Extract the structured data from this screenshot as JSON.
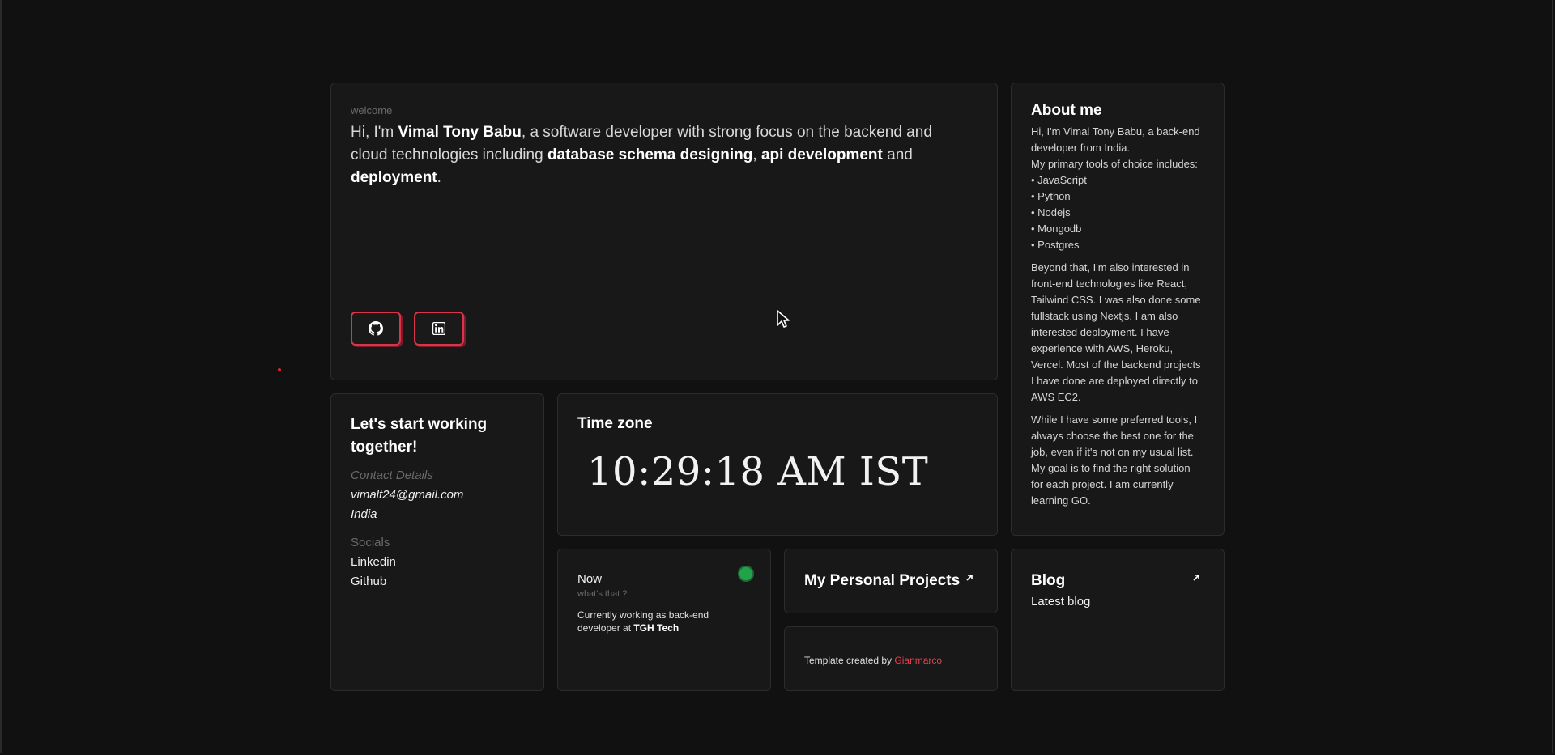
{
  "welcome": {
    "label": "welcome",
    "intro_parts": [
      {
        "text": "Hi, I'm ",
        "bold": false
      },
      {
        "text": "Vimal Tony Babu",
        "bold": true
      },
      {
        "text": ", a software developer with strong focus on the backend and cloud technologies including ",
        "bold": false
      },
      {
        "text": "database schema designing",
        "bold": true
      },
      {
        "text": ", ",
        "bold": false
      },
      {
        "text": "api development",
        "bold": true
      },
      {
        "text": " and ",
        "bold": false
      },
      {
        "text": "deployment",
        "bold": true
      },
      {
        "text": ".",
        "bold": false
      }
    ],
    "buttons": [
      {
        "name": "github-button",
        "icon": "github-icon"
      },
      {
        "name": "linkedin-button",
        "icon": "linkedin-icon"
      }
    ]
  },
  "about": {
    "title": "About me",
    "intro": "Hi, I'm Vimal Tony Babu, a back-end developer from India.",
    "tools_intro": "My primary tools of choice includes:",
    "tools": [
      "JavaScript",
      "Python",
      "Nodejs",
      "Mongodb",
      "Postgres"
    ],
    "paragraph1": "Beyond that, I'm also interested in front-end technologies like React, Tailwind CSS. I was also done some fullstack using Nextjs. I am also interested deployment. I have experience with AWS, Heroku, Vercel. Most of the backend projects I have done are deployed directly to AWS EC2.",
    "paragraph2": "While I have some preferred tools, I always choose the best one for the job, even if it's not on my usual list. My goal is to find the right solution for each project. I am currently learning GO."
  },
  "contact": {
    "title": "Let's start working together!",
    "details_label": "Contact Details",
    "email": "vimalt24@gmail.com",
    "country": "India",
    "socials_label": "Socials",
    "socials": [
      "Linkedin",
      "Github"
    ]
  },
  "timezone": {
    "title": "Time zone",
    "time": "10:29:18 AM IST"
  },
  "now": {
    "title": "Now",
    "question": "what's that ?",
    "desc_prefix": "Currently working as back-end developer at ",
    "company": "TGH Tech",
    "status_color": "#22a349"
  },
  "projects": {
    "title": "My Personal Projects",
    "icon": "arrow-up-right-icon"
  },
  "template": {
    "prefix": "Template created by ",
    "author": "Gianmarco"
  },
  "blog": {
    "title": "Blog",
    "latest": "Latest blog",
    "icon": "arrow-up-right-icon"
  },
  "colors": {
    "background": "#111111",
    "card": "#181818",
    "accent": "#d9344a",
    "status": "#22a349"
  }
}
